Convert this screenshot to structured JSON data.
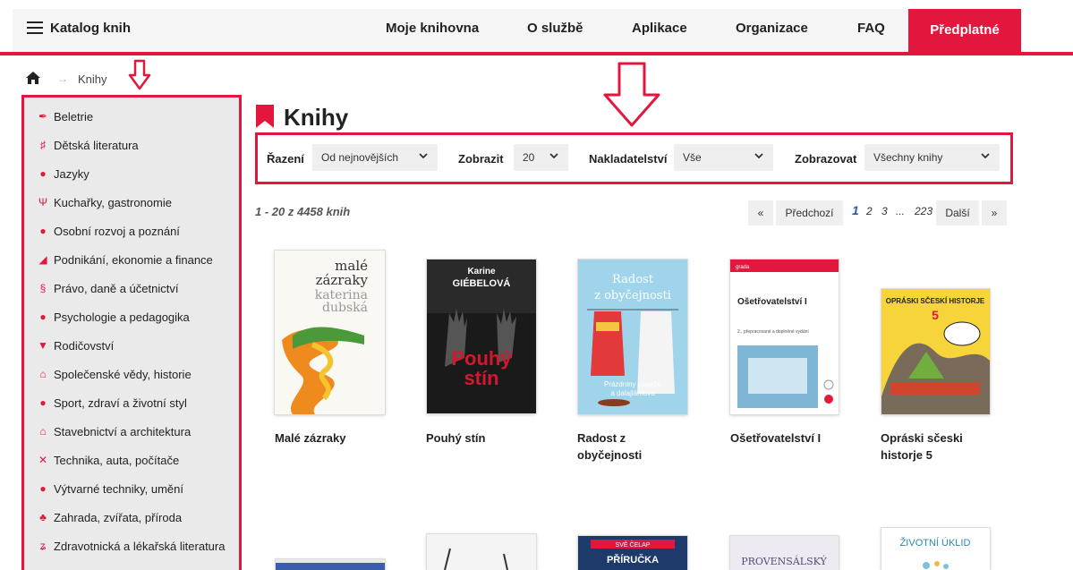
{
  "header": {
    "brand": "Katalog knih",
    "nav": [
      "Moje knihovna",
      "O službě",
      "Aplikace",
      "Organizace",
      "FAQ"
    ],
    "subscribe": "Předplatné"
  },
  "breadcrumb": {
    "current": "Knihy",
    "separator": "→"
  },
  "sidebar": {
    "categories": [
      "Beletrie",
      "Dětská literatura",
      "Jazyky",
      "Kuchařky, gastronomie",
      "Osobní rozvoj a poznání",
      "Podnikání, ekonomie a finance",
      "Právo, daně a účetnictví",
      "Psychologie a pedagogika",
      "Rodičovství",
      "Společenské vědy, historie",
      "Sport, zdraví a životní styl",
      "Stavebnictví a architektura",
      "Technika, auta, počítače",
      "Výtvarné techniky, umění",
      "Zahrada, zvířata, příroda",
      "Zdravotnická a lékařská literatura"
    ]
  },
  "main": {
    "title": "Knihy",
    "filters": {
      "sort_label": "Řazení",
      "sort_value": "Od nejnovějších",
      "show_label": "Zobrazit",
      "show_value": "20",
      "publisher_label": "Nakladatelství",
      "publisher_value": "Vše",
      "display_label": "Zobrazovat",
      "display_value": "Všechny knihy"
    },
    "count": "1 - 20 z 4458 knih",
    "pagination": {
      "first": "«",
      "prev": "Předchozí",
      "pages": [
        "1",
        "2",
        "3",
        "...",
        "223"
      ],
      "next": "Další",
      "last": "»"
    },
    "books": [
      {
        "title": "Malé zázraky",
        "cover_text": [
          "malé",
          "zázraky",
          "katerina",
          "dubská"
        ]
      },
      {
        "title": "Pouhý stín",
        "cover_text": [
          "Karine",
          "GIÉBELOVÁ",
          "Pouhý",
          "stín"
        ]
      },
      {
        "title": "Radost z obyčejnosti",
        "cover_text": [
          "Radost",
          "z obyčejnosti",
          "Prázdniny papeže",
          "a dalajlámova"
        ]
      },
      {
        "title": "Ošetřovatelství I",
        "cover_text": [
          "grada",
          "Ošetřovatelství I",
          "2., přepracované a doplněné vydání"
        ]
      },
      {
        "title": "Opráski sčeski historje 5",
        "cover_text": [
          "OPRÁSKI SČESKÍ HISTORJE",
          "5"
        ]
      }
    ],
    "books_row2_cover_text": [
      "SVĚ ČELAP",
      "PŘÍRUČKA",
      "PROVENSÁLSKÝ",
      "ŽIVOTNÍ ÚKLID"
    ]
  },
  "colors": {
    "accent": "#e3173d",
    "link": "#2a5db0"
  }
}
